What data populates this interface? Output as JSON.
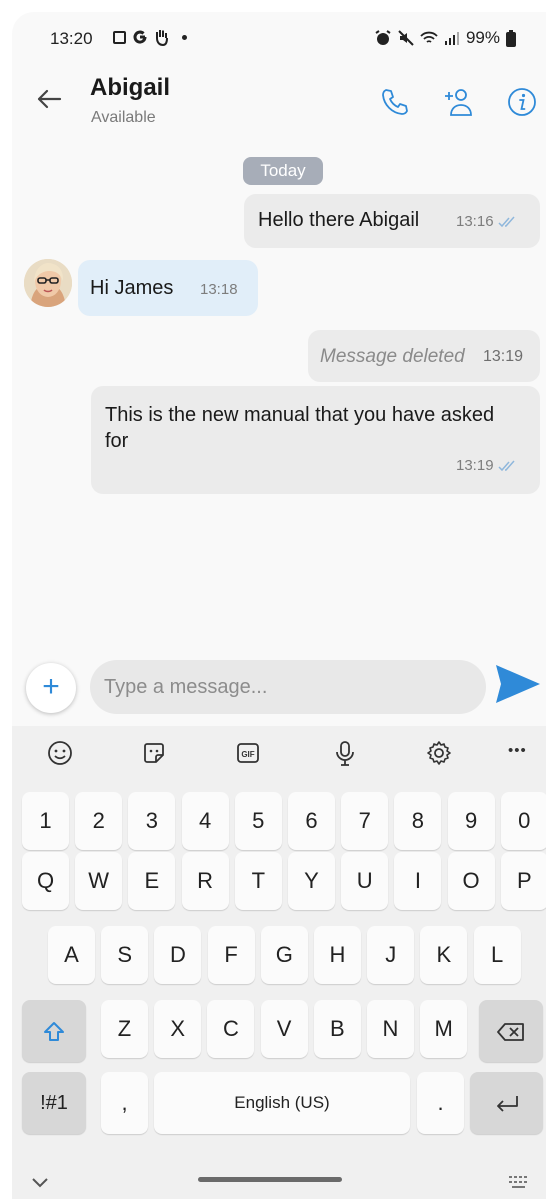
{
  "status_bar": {
    "time": "13:20",
    "battery": "99%"
  },
  "header": {
    "contact_name": "Abigail",
    "contact_status": "Available"
  },
  "chat": {
    "date_label": "Today",
    "messages": [
      {
        "direction": "outgoing",
        "text": "Hello there Abigail",
        "time": "13:16"
      },
      {
        "direction": "incoming",
        "text": "Hi James",
        "time": "13:18"
      },
      {
        "direction": "outgoing",
        "text": "Message deleted",
        "time": "13:19"
      },
      {
        "direction": "outgoing",
        "text": "This is the new manual that you have asked for",
        "time": "13:19"
      }
    ]
  },
  "composer": {
    "add_label": "+",
    "placeholder": "Type a message..."
  },
  "keyboard": {
    "number_row": [
      "1",
      "2",
      "3",
      "4",
      "5",
      "6",
      "7",
      "8",
      "9",
      "0"
    ],
    "row1": [
      "Q",
      "W",
      "E",
      "R",
      "T",
      "Y",
      "U",
      "I",
      "O",
      "P"
    ],
    "row2": [
      "A",
      "S",
      "D",
      "F",
      "G",
      "H",
      "J",
      "K",
      "L"
    ],
    "row3": [
      "Z",
      "X",
      "C",
      "V",
      "B",
      "N",
      "M"
    ],
    "symbols_key": "!#1",
    "comma_key": ",",
    "space_key": "English (US)",
    "period_key": ".",
    "gif_label": "GIF",
    "more_label": "•••"
  },
  "colors": {
    "accent": "#2f8ad8",
    "incoming_bubble": "#e1eef9",
    "outgoing_bubble": "#ebebeb",
    "date_chip": "#a7adb8"
  }
}
